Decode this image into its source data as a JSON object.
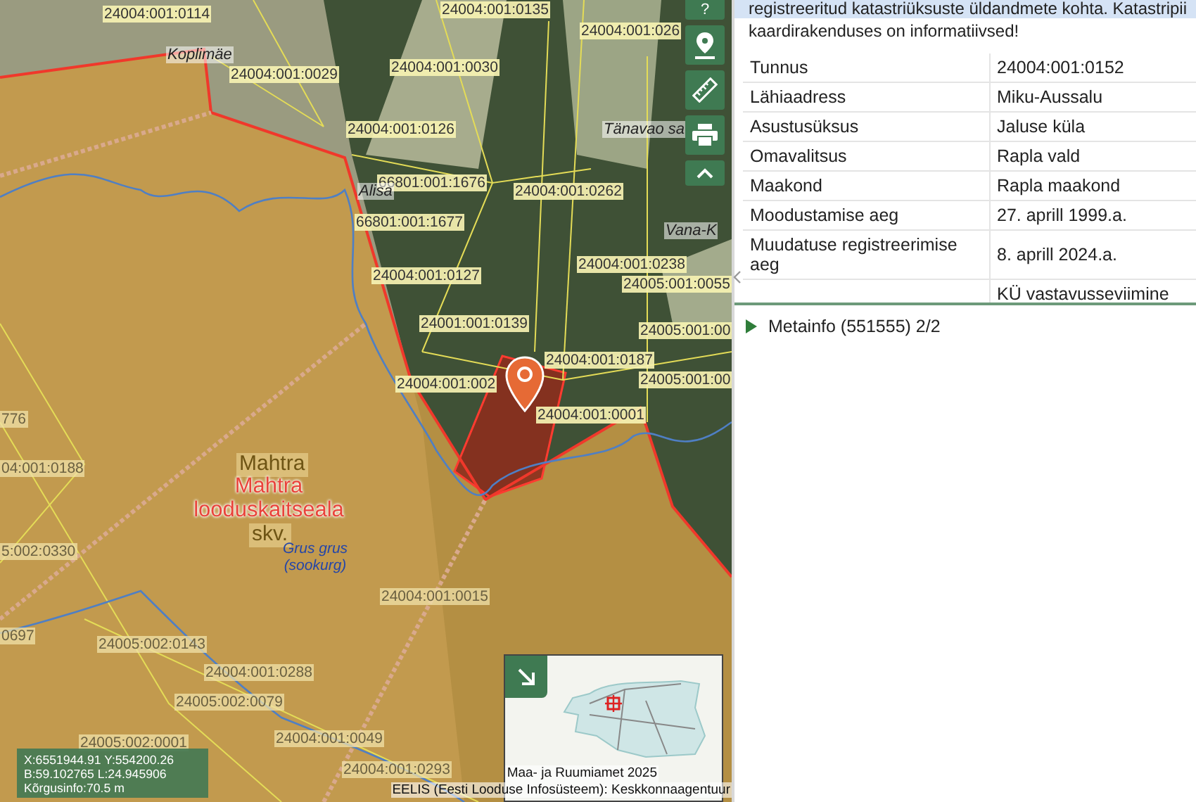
{
  "map": {
    "parcel_labels": [
      "24004:001:0114",
      "24004:001:0135",
      "24004:001:026",
      "24004:001:0029",
      "24004:001:0030",
      "24004:001:0126",
      "66801:001:1676",
      "24004:001:0262",
      "66801:001:1677",
      "24004:001:0127",
      "24004:001:0238",
      "24005:001:0055",
      "24001:001:0139",
      "24005:001:00",
      "24004:001:0187",
      "24005:001:00",
      "24004:001:002",
      "24004:001:0001",
      "776",
      "04:001:0188",
      "5:002:0330",
      "0697",
      "24004:001:0015",
      "24005:002:0143",
      "24004:001:0288",
      "24005:002:0079",
      "24005:002:0001",
      "24004:001:0049",
      "24004:001:0293"
    ],
    "place_names": [
      {
        "text": "Koplimäe",
        "kind": "place"
      },
      {
        "text": "Alisa",
        "kind": "place"
      },
      {
        "text": "Tänavao sa",
        "kind": "place"
      },
      {
        "text": "Vana-K",
        "kind": "place"
      },
      {
        "text": "Mahtra",
        "kind": "faded"
      },
      {
        "text": "Mahtra looduskaitseala",
        "kind": "protected"
      },
      {
        "text": "skv.",
        "kind": "faded"
      },
      {
        "text": "Grus grus (sookurg)",
        "kind": "species"
      }
    ],
    "coordinates": [
      "X:6551944.91 Y:554200.26",
      "B:59.102765 L:24.945906",
      "Kõrgusinfo:70.5 m"
    ],
    "attribution": [
      "Maa- ja Ruumiamet 2025",
      "EELIS (Eesti Looduse Infosüsteem): Keskkonnaagentuur"
    ],
    "help_button": "?"
  },
  "info_panel": {
    "notice_lines": [
      "registreeritud katastriüksuste üldandmete kohta. Katastripii",
      "kaardirakenduses on informatiivsed!"
    ],
    "rows": [
      {
        "label": "Tunnus",
        "value": "24004:001:0152"
      },
      {
        "label": "Lähiaadress",
        "value": "Miku-Aussalu"
      },
      {
        "label": "Asustusüksus",
        "value": "Jaluse küla"
      },
      {
        "label": "Omavalitsus",
        "value": "Rapla vald"
      },
      {
        "label": "Maakond",
        "value": "Rapla maakond"
      },
      {
        "label": "Moodustamise aeg",
        "value": "27. aprill 1999.a."
      },
      {
        "label": "Muudatuse registreerimise aeg",
        "value": "8. aprill 2024.a."
      },
      {
        "value": "KÜ vastavusseviimine"
      }
    ],
    "section": {
      "title": "Metainfo (551555) 2/2",
      "expanded": false
    }
  }
}
